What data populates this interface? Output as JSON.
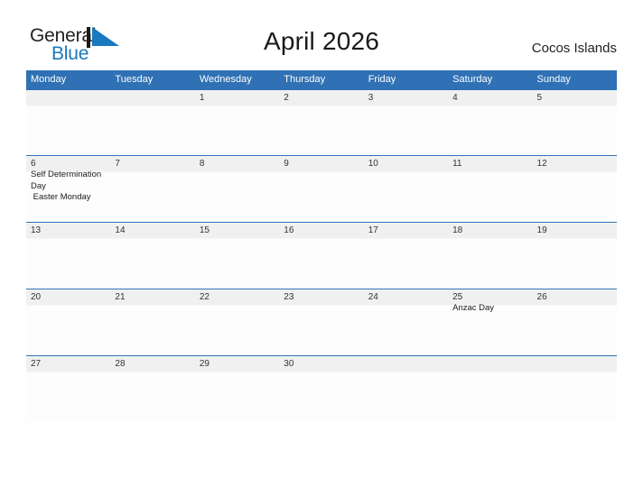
{
  "brand": {
    "name_part1": "General",
    "name_part2": "Blue",
    "mark": "triangle-flag-icon",
    "accent_color": "#1878c0"
  },
  "header": {
    "title": "April 2026",
    "location": "Cocos Islands"
  },
  "calendar": {
    "header_bg": "#2f71b4",
    "row_band_bg": "#f0f0f0",
    "weekday_headers": [
      "Monday",
      "Tuesday",
      "Wednesday",
      "Thursday",
      "Friday",
      "Saturday",
      "Sunday"
    ],
    "weeks": [
      {
        "days": [
          {
            "num": "",
            "events": []
          },
          {
            "num": "",
            "events": []
          },
          {
            "num": "1",
            "events": []
          },
          {
            "num": "2",
            "events": []
          },
          {
            "num": "3",
            "events": []
          },
          {
            "num": "4",
            "events": []
          },
          {
            "num": "5",
            "events": []
          }
        ]
      },
      {
        "days": [
          {
            "num": "6",
            "events": [
              "Self Determination Day",
              " Easter Monday"
            ]
          },
          {
            "num": "7",
            "events": []
          },
          {
            "num": "8",
            "events": []
          },
          {
            "num": "9",
            "events": []
          },
          {
            "num": "10",
            "events": []
          },
          {
            "num": "11",
            "events": []
          },
          {
            "num": "12",
            "events": []
          }
        ]
      },
      {
        "days": [
          {
            "num": "13",
            "events": []
          },
          {
            "num": "14",
            "events": []
          },
          {
            "num": "15",
            "events": []
          },
          {
            "num": "16",
            "events": []
          },
          {
            "num": "17",
            "events": []
          },
          {
            "num": "18",
            "events": []
          },
          {
            "num": "19",
            "events": []
          }
        ]
      },
      {
        "days": [
          {
            "num": "20",
            "events": []
          },
          {
            "num": "21",
            "events": []
          },
          {
            "num": "22",
            "events": []
          },
          {
            "num": "23",
            "events": []
          },
          {
            "num": "24",
            "events": []
          },
          {
            "num": "25",
            "events": [
              "Anzac Day"
            ]
          },
          {
            "num": "26",
            "events": []
          }
        ]
      },
      {
        "days": [
          {
            "num": "27",
            "events": []
          },
          {
            "num": "28",
            "events": []
          },
          {
            "num": "29",
            "events": []
          },
          {
            "num": "30",
            "events": []
          },
          {
            "num": "",
            "events": []
          },
          {
            "num": "",
            "events": []
          },
          {
            "num": "",
            "events": []
          }
        ]
      }
    ]
  }
}
